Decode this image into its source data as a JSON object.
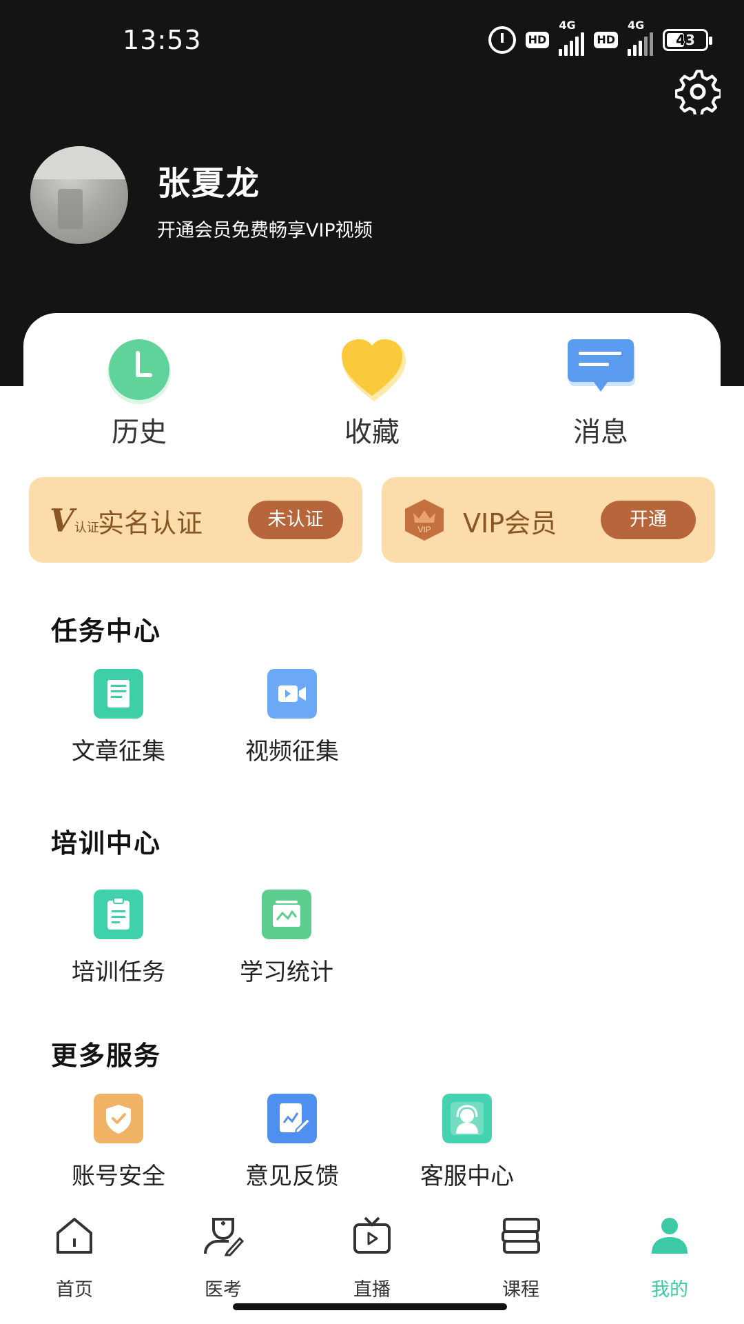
{
  "status_bar": {
    "time": "13:53",
    "hd1": "HD",
    "net1": "4G",
    "hd2": "HD",
    "net2": "4G",
    "battery": "43"
  },
  "header": {
    "user_name": "张夏龙",
    "subtitle": "开通会员免费畅享VIP视频"
  },
  "quick": [
    {
      "label": "历史",
      "icon": "clock-icon"
    },
    {
      "label": "收藏",
      "icon": "heart-icon"
    },
    {
      "label": "消息",
      "icon": "message-icon"
    }
  ],
  "promo": {
    "verify": {
      "label": "实名认证",
      "badge_text": "认证",
      "status": "未认证"
    },
    "vip": {
      "label": "VIP会员",
      "badge_text": "VIP",
      "action": "开通"
    }
  },
  "sections": {
    "task": {
      "title": "任务中心",
      "items": [
        {
          "label": "文章征集",
          "icon": "news-icon",
          "color": "#3ecfa9"
        },
        {
          "label": "视频征集",
          "icon": "video-camera-icon",
          "color": "#6ba8f5"
        }
      ]
    },
    "training": {
      "title": "培训中心",
      "items": [
        {
          "label": "培训任务",
          "icon": "clipboard-icon",
          "color": "#3fd0ac"
        },
        {
          "label": "学习统计",
          "icon": "stats-icon",
          "color": "#5ccd8e"
        }
      ]
    },
    "more": {
      "title": "更多服务",
      "items": [
        {
          "label": "账号安全",
          "icon": "shield-icon",
          "color": "#f0b264"
        },
        {
          "label": "意见反馈",
          "icon": "feedback-icon",
          "color": "#4f8ff0"
        },
        {
          "label": "客服中心",
          "icon": "support-icon",
          "color": "#44d2b0"
        }
      ]
    }
  },
  "nav": [
    {
      "label": "首页",
      "icon": "home-icon",
      "active": false
    },
    {
      "label": "医考",
      "icon": "doctor-icon",
      "active": false
    },
    {
      "label": "直播",
      "icon": "tv-icon",
      "active": false
    },
    {
      "label": "课程",
      "icon": "books-icon",
      "active": false
    },
    {
      "label": "我的",
      "icon": "profile-icon",
      "active": true
    }
  ],
  "colors": {
    "header_bg": "#141414",
    "accent": "#3cc9a6",
    "promo_bg": "#fbdcaa",
    "promo_button": "#b6663a"
  }
}
